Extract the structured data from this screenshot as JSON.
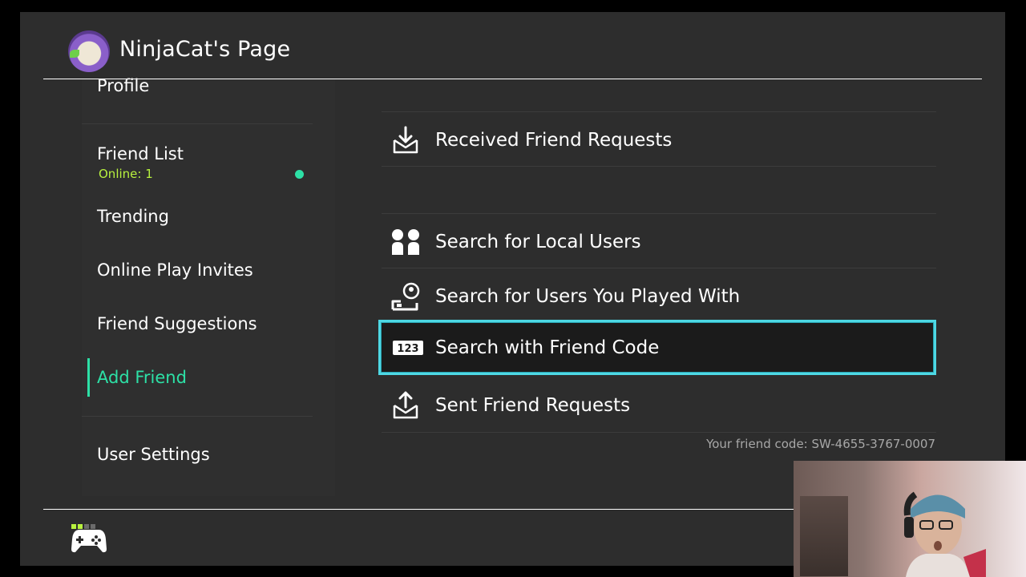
{
  "header": {
    "title": "NinjaCat's Page",
    "avatar_icon": "user-avatar"
  },
  "sidebar": {
    "items": [
      {
        "label": "Profile"
      },
      {
        "label": "Friend List",
        "sublabel": "Online: 1"
      },
      {
        "label": "Trending"
      },
      {
        "label": "Online Play Invites"
      },
      {
        "label": "Friend Suggestions"
      },
      {
        "label": "Add Friend",
        "active": true
      },
      {
        "label": "User Settings"
      }
    ]
  },
  "menu": {
    "items": [
      {
        "label": "Received Friend Requests",
        "icon": "download-inbox-icon"
      },
      {
        "label": "Search for Local Users",
        "icon": "local-users-icon"
      },
      {
        "label": "Search for Users You Played With",
        "icon": "played-with-icon"
      },
      {
        "label": "Search with Friend Code",
        "icon": "friend-code-icon",
        "icon_text": "123",
        "selected": true
      },
      {
        "label": "Sent Friend Requests",
        "icon": "upload-outbox-icon"
      }
    ],
    "friend_code": "Your friend code: SW-4655-3767-0007"
  },
  "colors": {
    "accent": "#2de0a6",
    "online_text": "#b8f23f",
    "selection_border": "#4ed8e4",
    "background": "#2d2d2d"
  }
}
